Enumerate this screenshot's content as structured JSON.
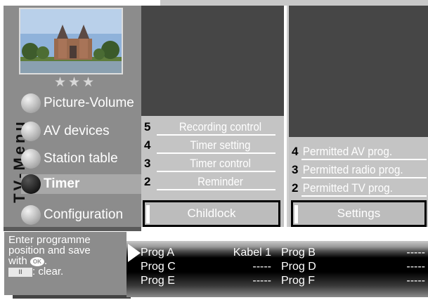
{
  "sidebar": {
    "title": "TV-Menu",
    "rating_stars": "★★★",
    "items": [
      {
        "label": "Picture-Volume",
        "active": false
      },
      {
        "label": "AV devices",
        "active": false
      },
      {
        "label": "Station table",
        "active": false
      },
      {
        "label": "Timer",
        "active": true
      },
      {
        "label": "Configuration",
        "active": false
      }
    ]
  },
  "timer_menu": {
    "items": [
      {
        "num": "5",
        "label": "Recording control"
      },
      {
        "num": "4",
        "label": "Timer setting"
      },
      {
        "num": "3",
        "label": "Timer control"
      },
      {
        "num": "2",
        "label": "Reminder"
      }
    ],
    "selected": "Childlock"
  },
  "childlock_menu": {
    "items": [
      {
        "num": "4",
        "label": "Permitted AV prog."
      },
      {
        "num": "3",
        "label": "Permitted radio prog."
      },
      {
        "num": "2",
        "label": "Permitted TV prog."
      }
    ],
    "selected": "Settings"
  },
  "hint": {
    "line1": "Enter programme",
    "line2": "position and save",
    "line3_prefix": "with",
    "ok_key": "OK",
    "line3_suffix": ".",
    "clear_key": "II",
    "clear_text": ": clear."
  },
  "programmes": [
    {
      "left_name": "Prog A",
      "left_value": "Kabel 1",
      "right_name": "Prog B",
      "right_value": "-----"
    },
    {
      "left_name": "Prog C",
      "left_value": "-----",
      "right_name": "Prog D",
      "right_value": "-----"
    },
    {
      "left_name": "Prog E",
      "left_value": "-----",
      "right_name": "Prog F",
      "right_value": "-----"
    }
  ],
  "colors": {
    "menu_grey": "#8c8c8c",
    "preview_dark": "#464646",
    "list_grey": "#c4c4c4"
  }
}
